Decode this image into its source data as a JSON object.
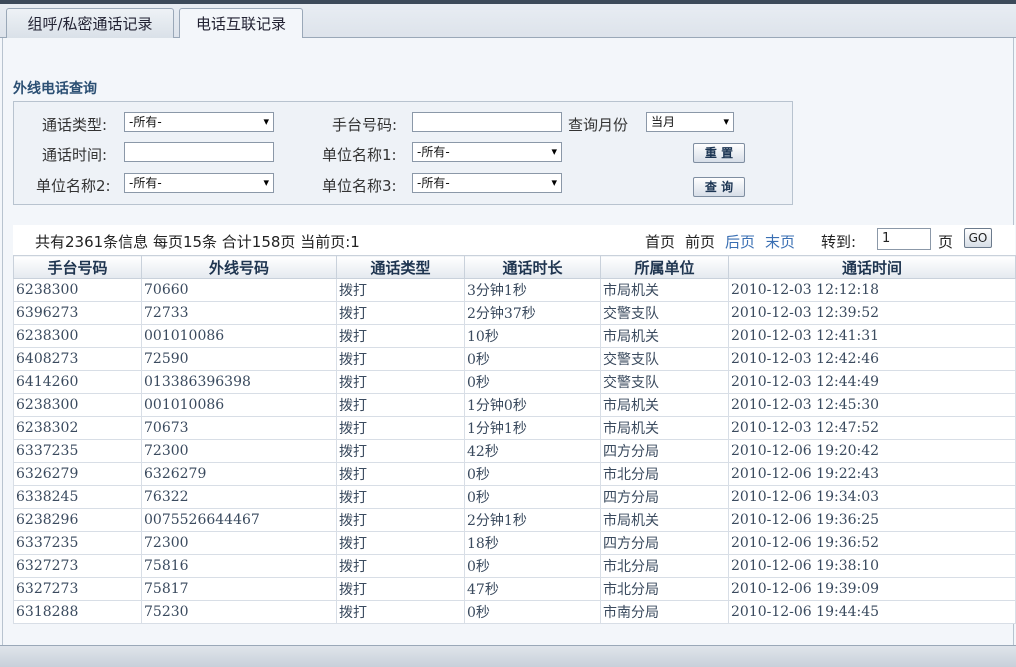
{
  "tabs": [
    {
      "label": "组呼/私密通话记录"
    },
    {
      "label": "电话互联记录"
    }
  ],
  "search": {
    "title": "外线电话查询",
    "call_type_label": "通话类型:",
    "call_type_value": "-所有-",
    "handset_label": "手台号码:",
    "handset_value": "",
    "month_label": "查询月份",
    "month_value": "当月",
    "call_time_label": "通话时间:",
    "call_time_value": "",
    "unit1_label": "单位名称1:",
    "unit1_value": "-所有-",
    "unit2_label": "单位名称2:",
    "unit2_value": "-所有-",
    "unit3_label": "单位名称3:",
    "unit3_value": "-所有-",
    "reset_label": "重 置",
    "query_label": "查 询"
  },
  "pager": {
    "summary": "共有2361条信息 每页15条 合计158页  当前页:1",
    "first": "首页",
    "prev": "前页",
    "next": "后页",
    "last": "末页",
    "goto_label": "转到:",
    "goto_value": "1",
    "page_unit": "页",
    "go": "GO"
  },
  "table": {
    "headers": [
      "手台号码",
      "外线号码",
      "通话类型",
      "通话时长",
      "所属单位",
      "通话时间"
    ],
    "rows": [
      [
        "6238300",
        "70660",
        "拨打",
        "3分钟1秒",
        "市局机关",
        "2010-12-03 12:12:18"
      ],
      [
        "6396273",
        "72733",
        "拨打",
        "2分钟37秒",
        "交警支队",
        "2010-12-03 12:39:52"
      ],
      [
        "6238300",
        "001010086",
        "拨打",
        "10秒",
        "市局机关",
        "2010-12-03 12:41:31"
      ],
      [
        "6408273",
        "72590",
        "拨打",
        "0秒",
        "交警支队",
        "2010-12-03 12:42:46"
      ],
      [
        "6414260",
        "013386396398",
        "拨打",
        "0秒",
        "交警支队",
        "2010-12-03 12:44:49"
      ],
      [
        "6238300",
        "001010086",
        "拨打",
        "1分钟0秒",
        "市局机关",
        "2010-12-03 12:45:30"
      ],
      [
        "6238302",
        "70673",
        "拨打",
        "1分钟1秒",
        "市局机关",
        "2010-12-03 12:47:52"
      ],
      [
        "6337235",
        "72300",
        "拨打",
        "42秒",
        "四方分局",
        "2010-12-06 19:20:42"
      ],
      [
        "6326279",
        "6326279",
        "拨打",
        "0秒",
        "市北分局",
        "2010-12-06 19:22:43"
      ],
      [
        "6338245",
        "76322",
        "拨打",
        "0秒",
        "四方分局",
        "2010-12-06 19:34:03"
      ],
      [
        "6238296",
        "0075526644467",
        "拨打",
        "2分钟1秒",
        "市局机关",
        "2010-12-06 19:36:25"
      ],
      [
        "6337235",
        "72300",
        "拨打",
        "18秒",
        "四方分局",
        "2010-12-06 19:36:52"
      ],
      [
        "6327273",
        "75816",
        "拨打",
        "0秒",
        "市北分局",
        "2010-12-06 19:38:10"
      ],
      [
        "6327273",
        "75817",
        "拨打",
        "47秒",
        "市北分局",
        "2010-12-06 19:39:09"
      ],
      [
        "6318288",
        "75230",
        "拨打",
        "0秒",
        "市南分局",
        "2010-12-06 19:44:45"
      ]
    ]
  }
}
